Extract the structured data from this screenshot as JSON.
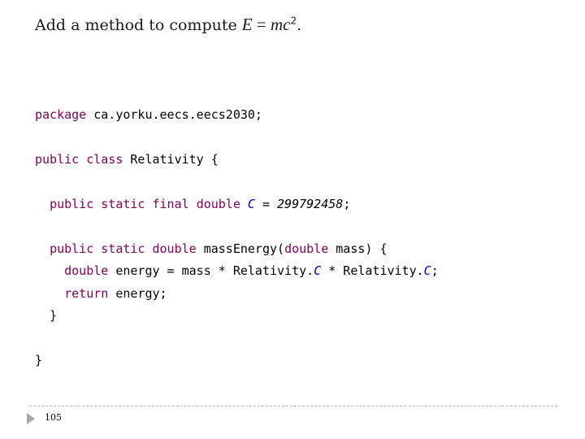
{
  "slide": {
    "title_text": "Add a method to compute ",
    "title_math_E": "E",
    "title_math_eq": " = ",
    "title_math_mc": "mc",
    "title_math_exp": "2",
    "title_end": ".",
    "page_number": "105"
  },
  "code": {
    "line1": {
      "kw": "package",
      "rest": " ca.yorku.eecs.eecs2030;"
    },
    "line2": {
      "kw1": "public",
      "kw2": "class",
      "rest": " Relativity {"
    },
    "line3": {
      "indent": "  ",
      "kw1": "public",
      "kw2": "static",
      "kw3": "final",
      "kw4": "double",
      "const": "C",
      "eq": " = ",
      "num": "299792458",
      "end": ";"
    },
    "line4": {
      "indent": "  ",
      "kw1": "public",
      "kw2": "static",
      "kw3": "double",
      "name": " massEnergy(",
      "kw4": "double",
      "rest": " mass) {"
    },
    "line5": {
      "indent": "    ",
      "kw": "double",
      "rest1": " energy = mass * Relativity.",
      "const1": "C",
      "rest2": " * Relativity.",
      "const2": "C",
      "end": ";"
    },
    "line6": {
      "indent": "    ",
      "kw": "return",
      "rest": " energy;"
    },
    "line7": {
      "text": "  }"
    },
    "line8": {
      "text": "}"
    }
  }
}
